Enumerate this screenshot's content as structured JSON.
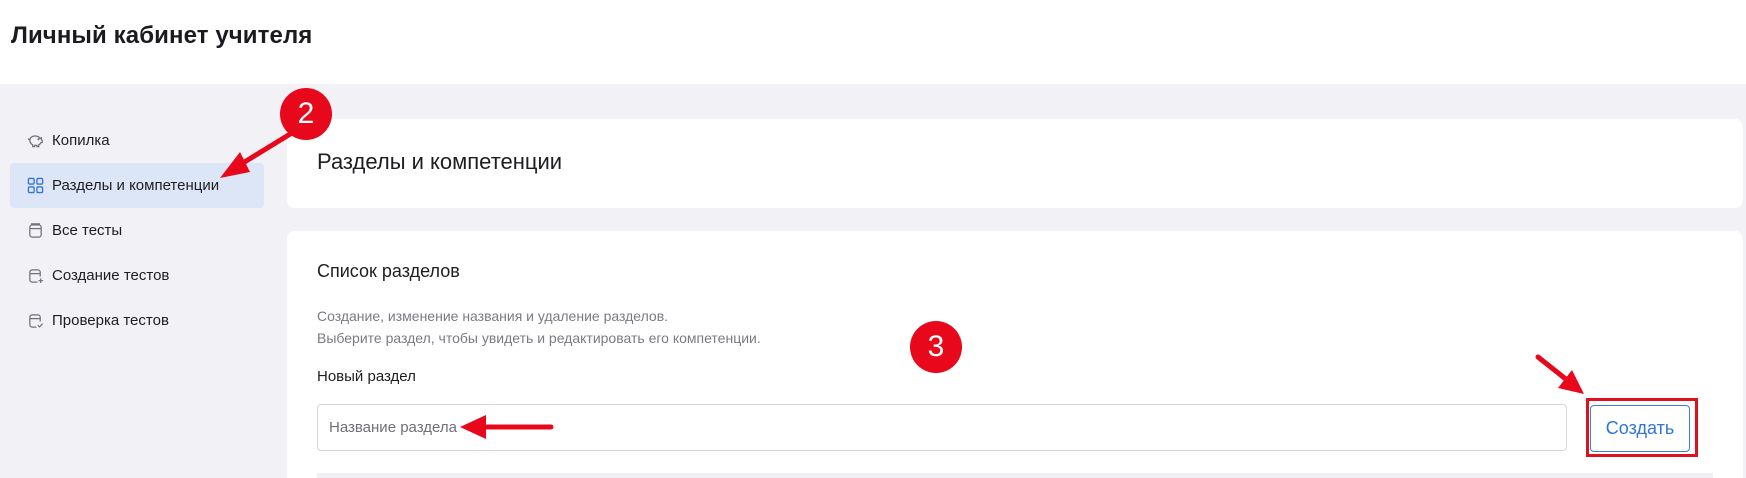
{
  "header": {
    "title": "Личный кабинет учителя"
  },
  "sidebar": {
    "items": [
      {
        "label": "Копилка",
        "icon": "piggy-bank-icon",
        "active": false
      },
      {
        "label": "Разделы и компетенции",
        "icon": "grid-icon",
        "active": true
      },
      {
        "label": "Все тесты",
        "icon": "tests-icon",
        "active": false
      },
      {
        "label": "Создание тестов",
        "icon": "test-add-icon",
        "active": false
      },
      {
        "label": "Проверка тестов",
        "icon": "test-check-icon",
        "active": false
      }
    ]
  },
  "page": {
    "title": "Разделы и компетенции"
  },
  "sections": {
    "heading": "Список разделов",
    "description_line1": "Создание, изменение названия и удаление разделов.",
    "description_line2": "Выберите раздел, чтобы увидеть и редактировать его компетенции.",
    "new_section_label": "Новый раздел",
    "input_placeholder": "Название раздела",
    "input_value": "",
    "create_label": "Создать"
  },
  "annotations": {
    "badge_2": "2",
    "badge_3": "3",
    "color": "#e8081c"
  },
  "colors": {
    "accent": "#2f74dc",
    "active_nav_bg": "#dde6f6",
    "page_bg": "#f2f2f6"
  }
}
